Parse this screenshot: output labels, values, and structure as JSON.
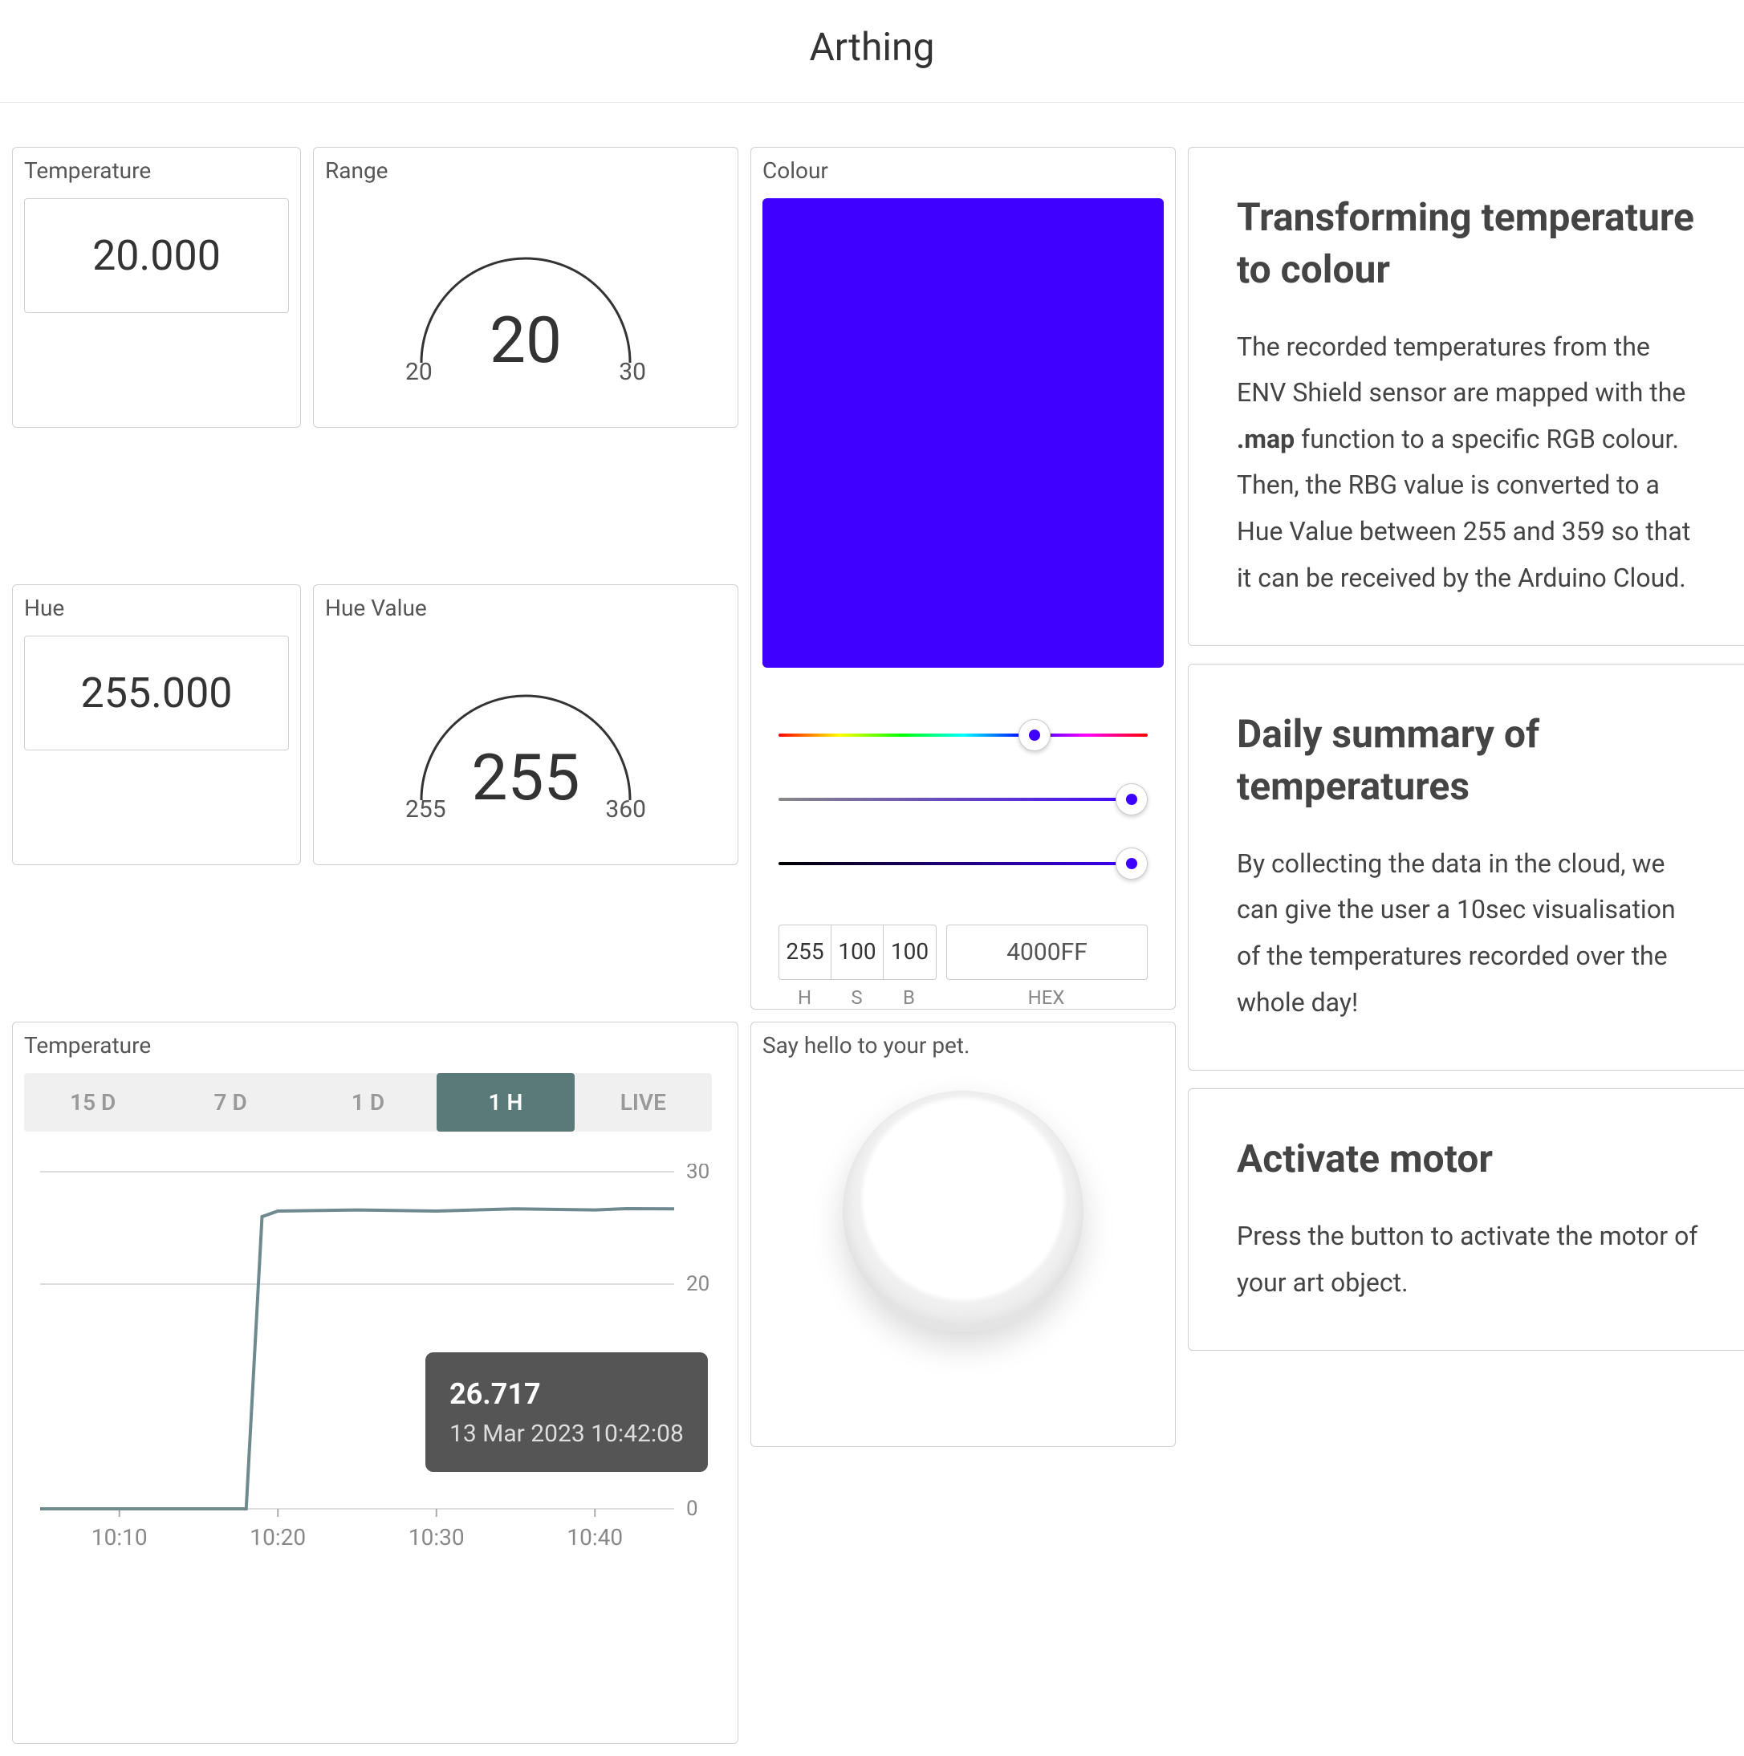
{
  "header": {
    "title": "Arthing"
  },
  "temperature_card": {
    "title": "Temperature",
    "value": "20.000"
  },
  "range_card": {
    "title": "Range",
    "value": "20",
    "min": "20",
    "max": "30"
  },
  "hue_card": {
    "title": "Hue",
    "value": "255.000"
  },
  "hue_value_card": {
    "title": "Hue Value",
    "value": "255",
    "min": "255",
    "max": "360"
  },
  "colour_card": {
    "title": "Colour",
    "swatch": "#4000FF",
    "h": "255",
    "s": "100",
    "b": "100",
    "hex": "4000FF",
    "h_label": "H",
    "s_label": "S",
    "b_label": "B",
    "hex_label": "HEX"
  },
  "pet_card": {
    "title": "Say hello to your pet."
  },
  "chart_card": {
    "title": "Temperature",
    "tabs": [
      "15 D",
      "7 D",
      "1 D",
      "1 H",
      "LIVE"
    ],
    "active_tab": "1 H",
    "tooltip_value": "26.717",
    "tooltip_date": "13 Mar 2023 10:42:08"
  },
  "chart_data": {
    "type": "line",
    "title": "Temperature",
    "xlabel": "",
    "ylabel": "",
    "ylim": [
      0,
      30
    ],
    "yticks": [
      0,
      20,
      30
    ],
    "xticks": [
      "10:10",
      "10:20",
      "10:30",
      "10:40"
    ],
    "series": [
      {
        "name": "Temperature",
        "x": [
          "10:05",
          "10:10",
          "10:15",
          "10:18",
          "10:19",
          "10:20",
          "10:25",
          "10:30",
          "10:35",
          "10:40",
          "10:42",
          "10:45"
        ],
        "y": [
          0,
          0,
          0,
          0,
          26,
          26.5,
          26.6,
          26.5,
          26.7,
          26.6,
          26.717,
          26.7
        ]
      }
    ]
  },
  "info": {
    "card1": {
      "title": "Transforming temperature to colour",
      "text_a": "The recorded temperatures from the ENV Shield sensor are mapped with the ",
      "text_b": ".map",
      "text_c": " function to a specific RGB colour. Then, the RBG value is converted to a Hue Value between 255 and 359 so that it can be received by the Arduino Cloud."
    },
    "card2": {
      "title": "Daily summary of temperatures",
      "text": "By collecting the data in the cloud, we can give the user a 10sec visualisation of the temperatures recorded over the whole day!"
    },
    "card3": {
      "title": "Activate motor",
      "text": "Press the button to activate the motor of your art object."
    }
  }
}
